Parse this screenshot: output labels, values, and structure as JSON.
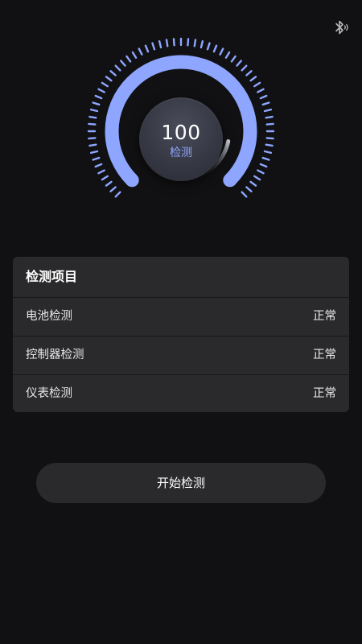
{
  "header": {
    "bluetooth_icon": "bluetooth-icon"
  },
  "gauge": {
    "score": "100",
    "label": "检测",
    "progress_fraction": 1.0,
    "accent_color": "#8ea6ff"
  },
  "panel": {
    "title": "检测项目",
    "items": [
      {
        "label": "电池检测",
        "status": "正常"
      },
      {
        "label": "控制器检测",
        "status": "正常"
      },
      {
        "label": "仪表检测",
        "status": "正常"
      }
    ]
  },
  "actions": {
    "start_label": "开始检测"
  }
}
